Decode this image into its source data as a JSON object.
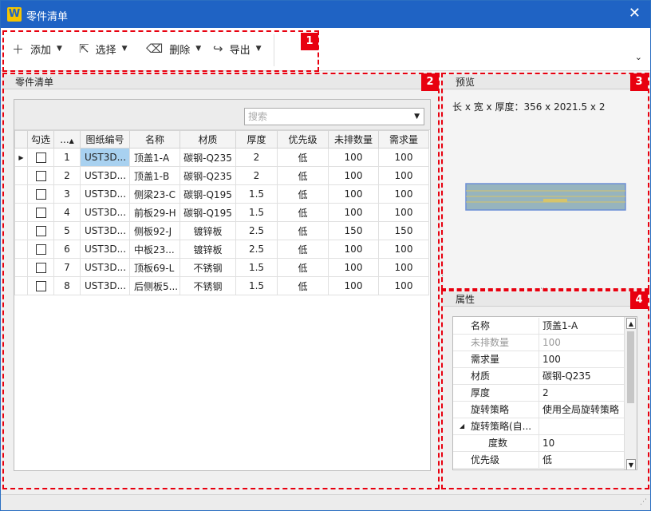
{
  "window": {
    "title": "零件清单",
    "logo": "W",
    "close_glyph": "✕"
  },
  "toolbar": {
    "add": {
      "label": "添加",
      "icon": "plus-icon"
    },
    "select": {
      "label": "选择",
      "icon": "cursor-icon"
    },
    "delete": {
      "label": "删除",
      "icon": "eraser-icon"
    },
    "export": {
      "label": "导出",
      "icon": "export-arrow-icon"
    }
  },
  "badges": [
    "1",
    "2",
    "3",
    "4"
  ],
  "parts_panel": {
    "title": "零件清单",
    "search_placeholder": "搜索",
    "columns": [
      "勾选",
      "...",
      "图纸编号",
      "名称",
      "材质",
      "厚度",
      "优先级",
      "未排数量",
      "需求量"
    ],
    "rows": [
      {
        "no": "1",
        "drawing": "UST3D...",
        "name": "顶盖1-A",
        "material": "碳钢-Q235",
        "thickness": "2",
        "priority": "低",
        "unplaced": "100",
        "required": "100"
      },
      {
        "no": "2",
        "drawing": "UST3D...",
        "name": "顶盖1-B",
        "material": "碳钢-Q235",
        "thickness": "2",
        "priority": "低",
        "unplaced": "100",
        "required": "100"
      },
      {
        "no": "3",
        "drawing": "UST3D...",
        "name": "侧梁23-C",
        "material": "碳钢-Q195",
        "thickness": "1.5",
        "priority": "低",
        "unplaced": "100",
        "required": "100"
      },
      {
        "no": "4",
        "drawing": "UST3D...",
        "name": "前板29-H",
        "material": "碳钢-Q195",
        "thickness": "1.5",
        "priority": "低",
        "unplaced": "100",
        "required": "100"
      },
      {
        "no": "5",
        "drawing": "UST3D...",
        "name": "侧板92-J",
        "material": "镀锌板",
        "thickness": "2.5",
        "priority": "低",
        "unplaced": "150",
        "required": "150"
      },
      {
        "no": "6",
        "drawing": "UST3D...",
        "name": "中板23...",
        "material": "镀锌板",
        "thickness": "2.5",
        "priority": "低",
        "unplaced": "100",
        "required": "100"
      },
      {
        "no": "7",
        "drawing": "UST3D...",
        "name": "顶板69-L",
        "material": "不锈钢",
        "thickness": "1.5",
        "priority": "低",
        "unplaced": "100",
        "required": "100"
      },
      {
        "no": "8",
        "drawing": "UST3D...",
        "name": "后侧板5...",
        "material": "不锈钢",
        "thickness": "1.5",
        "priority": "低",
        "unplaced": "100",
        "required": "100"
      }
    ]
  },
  "preview_panel": {
    "title": "预览",
    "dimensions": "长 x 宽 x 厚度：356 x 2021.5 x 2"
  },
  "properties_panel": {
    "title": "属性",
    "rows": [
      {
        "key": "名称",
        "value": "顶盖1-A"
      },
      {
        "key": "未排数量",
        "value": "100"
      },
      {
        "key": "需求量",
        "value": "100"
      },
      {
        "key": "材质",
        "value": "碳钢-Q235"
      },
      {
        "key": "厚度",
        "value": "2"
      },
      {
        "key": "旋转策略",
        "value": "使用全局旋转策略"
      },
      {
        "key": "旋转策略(自...",
        "value": ""
      },
      {
        "key": "度数",
        "value": "10"
      },
      {
        "key": "优先级",
        "value": "低"
      }
    ]
  },
  "colors": {
    "titlebar": "#1f63c4",
    "selection": "#a8d1f0",
    "annotation": "#e8000f",
    "preview_part": "#96b4be"
  }
}
